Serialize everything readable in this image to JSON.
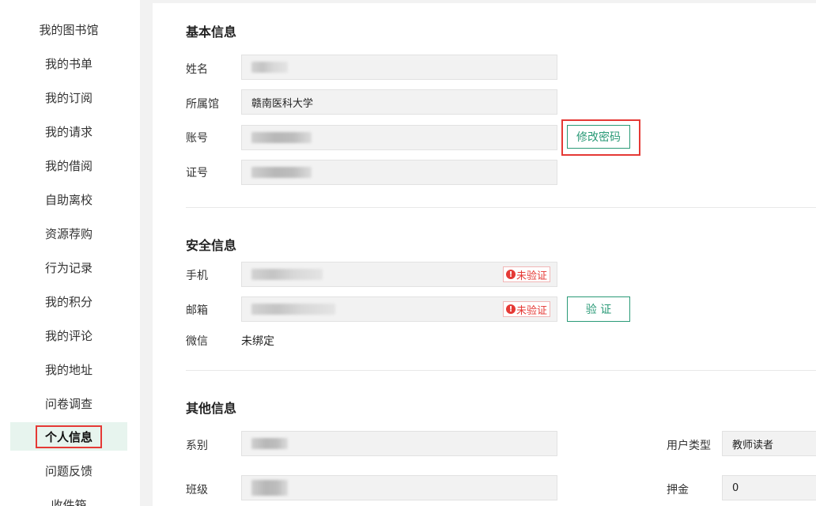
{
  "sidebar": {
    "items": [
      {
        "label": "我的图书馆"
      },
      {
        "label": "我的书单"
      },
      {
        "label": "我的订阅"
      },
      {
        "label": "我的请求"
      },
      {
        "label": "我的借阅"
      },
      {
        "label": "自助离校"
      },
      {
        "label": "资源荐购"
      },
      {
        "label": "行为记录"
      },
      {
        "label": "我的积分"
      },
      {
        "label": "我的评论"
      },
      {
        "label": "我的地址"
      },
      {
        "label": "问卷调查"
      },
      {
        "label": "个人信息"
      },
      {
        "label": "问题反馈"
      },
      {
        "label": "收件箱"
      }
    ],
    "active_index": 12
  },
  "basic": {
    "title": "基本信息",
    "name_label": "姓名",
    "library_label": "所属馆",
    "library_value": "赣南医科大学",
    "account_label": "账号",
    "change_password": "修改密码",
    "card_label": "证号"
  },
  "security": {
    "title": "安全信息",
    "phone_label": "手机",
    "phone_badge": "未验证",
    "email_label": "邮箱",
    "email_badge": "未验证",
    "verify_button": "验 证",
    "wechat_label": "微信",
    "wechat_value": "未绑定"
  },
  "other": {
    "title": "其他信息",
    "dept_label": "系别",
    "class_label": "班级",
    "user_type_label": "用户类型",
    "user_type_value": "教师读者",
    "deposit_label": "押金",
    "deposit_value": "0"
  },
  "colors": {
    "accent": "#2a9a77",
    "highlight": "#e53935",
    "active_bg": "#e7f4ee"
  }
}
